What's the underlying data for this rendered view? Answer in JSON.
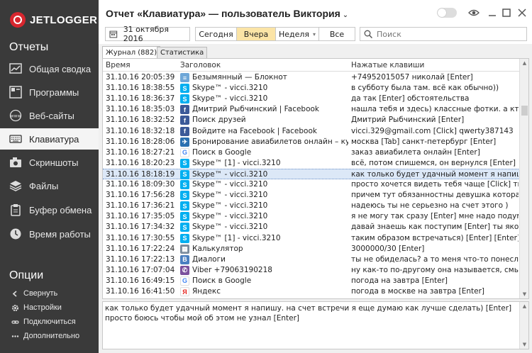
{
  "app": {
    "logo_text": "JETLOGGER"
  },
  "sidebar": {
    "reports_title": "Отчеты",
    "items": [
      {
        "label": "Общая сводка",
        "icon": "chart-icon"
      },
      {
        "label": "Программы",
        "icon": "programs-icon"
      },
      {
        "label": "Веб-сайты",
        "icon": "www-icon"
      },
      {
        "label": "Клавиатура",
        "icon": "keyboard-icon",
        "active": true
      },
      {
        "label": "Скриншоты",
        "icon": "camera-icon"
      },
      {
        "label": "Файлы",
        "icon": "files-icon"
      },
      {
        "label": "Буфер обмена",
        "icon": "clipboard-icon"
      },
      {
        "label": "Время работы",
        "icon": "clock-icon"
      }
    ],
    "options_title": "Опции",
    "options": [
      {
        "label": "Свернуть",
        "icon": "chevron-left-icon"
      },
      {
        "label": "Настройки",
        "icon": "gear-icon"
      },
      {
        "label": "Подключиться",
        "icon": "link-icon"
      },
      {
        "label": "Дополнительно",
        "icon": "more-icon"
      }
    ]
  },
  "header": {
    "title": "Отчет «Клавиатура» — пользователь Виктория",
    "chevron": "⌄"
  },
  "toolbar": {
    "date": "31 октября 2016",
    "today": "Сегодня",
    "yesterday": "Вчера",
    "week": "Неделя",
    "week_arrow": "▾",
    "all": "Все",
    "search_placeholder": "Поиск"
  },
  "tabs": {
    "journal": "Журнал (882)",
    "stats": "Статистика"
  },
  "table": {
    "columns": [
      "Время",
      "Заголовок",
      "Нажатые клавиши"
    ],
    "rows": [
      {
        "time": "31.10.16 20:05:39",
        "icon": "notepad",
        "title": "Безымянный — Блокнот",
        "keys": "+74952015057 николай [Enter]"
      },
      {
        "time": "31.10.16 18:38:55",
        "icon": "skype",
        "title": "Skype™ - vicci.3210",
        "keys": "в субботу была там. всё как обычно))"
      },
      {
        "time": "31.10.16 18:36:37",
        "icon": "skype",
        "title": "Skype™ - vicci.3210",
        "keys": "да так [Enter] обстоятельства"
      },
      {
        "time": "31.10.16 18:35:03",
        "icon": "facebook",
        "title": "Дмитрий Рыбчинский | Facebook",
        "keys": "нашла тебя и здесь) классные фотки. а кто р..."
      },
      {
        "time": "31.10.16 18:32:52",
        "icon": "facebook",
        "title": "Поиск друзей",
        "keys": "Дмитрий Рыбчинский [Enter]"
      },
      {
        "time": "31.10.16 18:32:18",
        "icon": "facebook",
        "title": "Войдите на Facebook | Facebook",
        "keys": "vicci.329@gmail.com [Click] qwerty387143"
      },
      {
        "time": "31.10.16 18:28:06",
        "icon": "plane",
        "title": "Бронирование авиабилетов онлайн – купит...",
        "keys": "москва [Tab] санкт-петербург [Enter]"
      },
      {
        "time": "31.10.16 18:27:21",
        "icon": "google",
        "title": "Поиск в Google",
        "keys": "заказ авиабилета онлайн [Enter]"
      },
      {
        "time": "31.10.16 18:20:23",
        "icon": "skype",
        "title": "Skype™ [1] - vicci.3210",
        "keys": "всё, потом спишемся, он вернулся [Enter]"
      },
      {
        "time": "31.10.16 18:18:19",
        "icon": "skype",
        "title": "Skype™ - vicci.3210",
        "keys": "как только будет удачный момент я напишу. ...",
        "selected": true
      },
      {
        "time": "31.10.16 18:09:30",
        "icon": "skype",
        "title": "Skype™ - vicci.3210",
        "keys": "просто хочется видеть тебя чаще [Click] ты с..."
      },
      {
        "time": "31.10.16 17:56:28",
        "icon": "skype",
        "title": "Skype™ - vicci.3210",
        "keys": "причем тут обязанностны девушка которая м..."
      },
      {
        "time": "31.10.16 17:36:21",
        "icon": "skype",
        "title": "Skype™ - vicci.3210",
        "keys": "надеюсь ты не серьезно на счет этого )"
      },
      {
        "time": "31.10.16 17:35:05",
        "icon": "skype",
        "title": "Skype™ - vicci.3210",
        "keys": "я не могу так сразу [Enter] мне надо подума..."
      },
      {
        "time": "31.10.16 17:34:32",
        "icon": "skype",
        "title": "Skype™ - vicci.3210",
        "keys": "давай знаешь как поступим [Enter] ты якобы ..."
      },
      {
        "time": "31.10.16 17:30:55",
        "icon": "skype",
        "title": "Skype™ [1] - vicci.3210",
        "keys": "таким образом встречаться) [Enter] [Enter] ..."
      },
      {
        "time": "31.10.16 17:22:24",
        "icon": "calc",
        "title": "Калькулятор",
        "keys": "3000000/30 [Enter]"
      },
      {
        "time": "31.10.16 17:22:13",
        "icon": "dialogs",
        "title": "Диалоги",
        "keys": "ты не обиделась? а то меня что-то понесло ..."
      },
      {
        "time": "31.10.16 17:07:04",
        "icon": "viber",
        "title": "Viber +79063190218",
        "keys": "ну как-то по-другому она называется, смысл ..."
      },
      {
        "time": "31.10.16 16:49:15",
        "icon": "google",
        "title": "Поиск в Google",
        "keys": "погода на завтра [Enter]"
      },
      {
        "time": "31.10.16 16:41:50",
        "icon": "yandex",
        "title": "Яндекс",
        "keys": "погода в москве на завтра [Enter]"
      }
    ]
  },
  "detail": {
    "line1": "как только будет удачный момент я напишу. на счет встречи я еще думаю как лучше сделать) [Enter]",
    "line2": "просто боюсь чтобы мой об этом не узнал [Enter]"
  },
  "colors": {
    "sidebar_bg": "#3a3a3a",
    "accent": "#d8262e",
    "selected_row": "#dce8f7",
    "active_filter": "#fbe4a6",
    "skype": "#00aff0",
    "facebook": "#3b5998",
    "viber": "#7b519d"
  }
}
